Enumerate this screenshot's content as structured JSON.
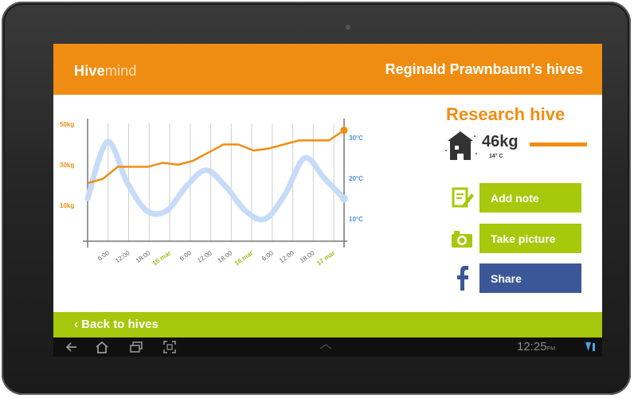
{
  "app": {
    "logo_part1": "Hive",
    "logo_part2": "mind",
    "owner_title": "Reginald Prawnbaum's hives"
  },
  "chart_data": {
    "type": "line",
    "left_axis": {
      "ticks": [
        "50kg",
        "30kg",
        "10kg"
      ],
      "values": [
        50,
        30,
        10
      ],
      "unit": "kg"
    },
    "right_axis": {
      "ticks": [
        "30°C",
        "20°C",
        "10°C"
      ],
      "values": [
        30,
        20,
        10
      ],
      "unit": "°C"
    },
    "x_labels": [
      {
        "text": "6:00",
        "is_date": false
      },
      {
        "text": "12:00",
        "is_date": false
      },
      {
        "text": "18:00",
        "is_date": false
      },
      {
        "text": "15 mar",
        "is_date": true
      },
      {
        "text": "6:00",
        "is_date": false
      },
      {
        "text": "12:00",
        "is_date": false
      },
      {
        "text": "18:00",
        "is_date": false
      },
      {
        "text": "16 mar",
        "is_date": true
      },
      {
        "text": "6:00",
        "is_date": false
      },
      {
        "text": "12:00",
        "is_date": false
      },
      {
        "text": "18:00",
        "is_date": false
      },
      {
        "text": "17 mar",
        "is_date": true
      }
    ],
    "series": [
      {
        "axis": "left",
        "color": "#ef8d12",
        "values": [
          21,
          23,
          29,
          29,
          29,
          31,
          30,
          32,
          36,
          40,
          40,
          37,
          38,
          40,
          42,
          42,
          42,
          47
        ]
      },
      {
        "axis": "right",
        "color": "#c6dbf7",
        "values": [
          15,
          29,
          19,
          12,
          12,
          18,
          22,
          18,
          12,
          10,
          16,
          25,
          20,
          15
        ]
      }
    ]
  },
  "hive": {
    "name": "Research hive",
    "weight": "46kg",
    "temperature": "14° C"
  },
  "actions": {
    "add_note": "Add note",
    "take_picture": "Take picture",
    "share": "Share"
  },
  "footer": {
    "back": "‹ Back to hives"
  },
  "status": {
    "time": "12:25",
    "ampm": "PM"
  },
  "colors": {
    "accent": "#ef8d12",
    "green": "#a7c80b",
    "facebook": "#3b5798",
    "temp_line": "#c6dbf7"
  }
}
